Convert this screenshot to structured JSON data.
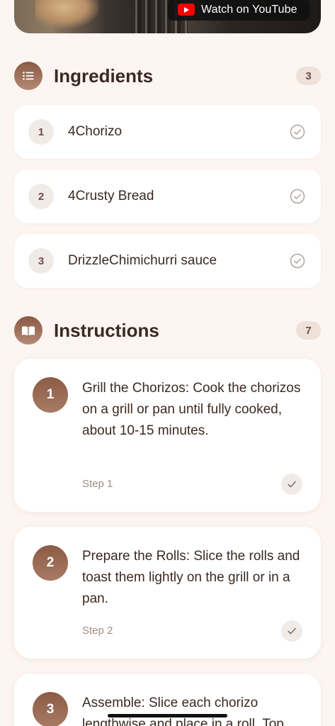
{
  "video": {
    "button_label": "Watch on YouTube",
    "logo_icon": "youtube-play-icon"
  },
  "ingredients": {
    "title": "Ingredients",
    "count": "3",
    "icon": "list-icon",
    "items": [
      {
        "index": "1",
        "name": "4Chorizo"
      },
      {
        "index": "2",
        "name": "4Crusty Bread"
      },
      {
        "index": "3",
        "name": "DrizzleChimichurri sauce"
      }
    ]
  },
  "instructions": {
    "title": "Instructions",
    "count": "7",
    "icon": "book-open-icon",
    "steps": [
      {
        "number": "1",
        "text": "Grill the Chorizos: Cook the chorizos on a grill or pan until fully cooked, about 10-15 minutes.",
        "label": "Step 1"
      },
      {
        "number": "2",
        "text": "Prepare the Rolls: Slice the rolls and toast them lightly on the grill or in a pan.",
        "label": "Step 2"
      },
      {
        "number": "3",
        "text": "Assemble: Slice each chorizo lengthwise and place in a roll. Top"
      }
    ]
  },
  "colors": {
    "background": "#fdf5f1",
    "accent": "#8c5b45",
    "youtube_red": "#ff0000"
  }
}
